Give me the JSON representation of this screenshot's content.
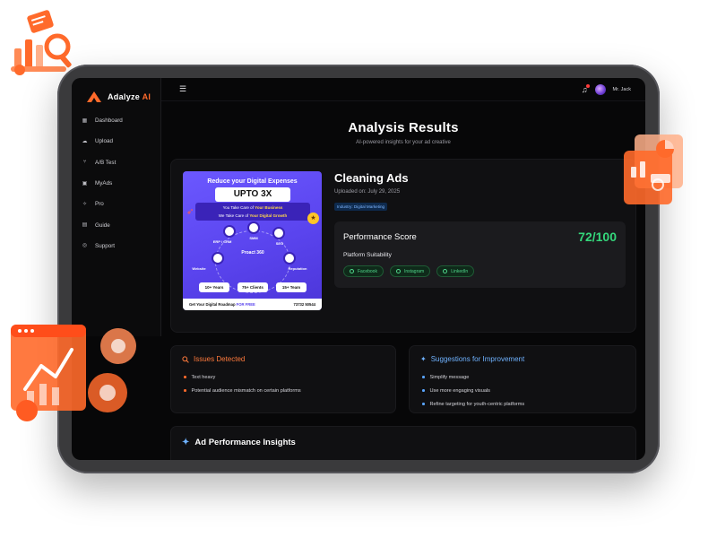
{
  "app": {
    "brand_name": "Adalyze",
    "brand_suffix": "AI"
  },
  "sidebar": {
    "items": [
      {
        "label": "Dashboard",
        "icon": "dashboard-icon"
      },
      {
        "label": "Upload",
        "icon": "upload-icon"
      },
      {
        "label": "A/B Test",
        "icon": "ab-test-icon"
      },
      {
        "label": "MyAds",
        "icon": "my-ads-icon"
      },
      {
        "label": "Pro",
        "icon": "pro-icon"
      },
      {
        "label": "Guide",
        "icon": "guide-icon"
      },
      {
        "label": "Support",
        "icon": "support-icon"
      }
    ]
  },
  "topbar": {
    "user_name": "Mr. Jack",
    "icons": [
      "menu-icon",
      "bell-icon",
      "avatar"
    ]
  },
  "page": {
    "title": "Analysis Results",
    "subtitle": "AI-powered insights for your ad creative"
  },
  "ad": {
    "title": "Cleaning Ads",
    "uploaded": "Uploaded on: July 29, 2025",
    "tag": "Industry: Digital Marketing",
    "creative": {
      "headline": "Reduce your Digital Expenses",
      "upto": "UPTO 3X",
      "line1_a": "You Take Care of ",
      "line1_b": "Your Business",
      "line2_a": "We Take Care of ",
      "line2_b": "Your Digital Growth",
      "center": "Proact 360",
      "nodes": [
        "ERP / CRM",
        "SMM",
        "SEO",
        "Website",
        "Reputation"
      ],
      "stats": [
        "10+ Years",
        "75+ Clients",
        "15+ Team"
      ],
      "footer_a": "Get Your Digital Roadmap ",
      "footer_b": "FOR FREE",
      "phone": "73732 50544"
    }
  },
  "performance": {
    "label": "Performance Score",
    "score": "72/100",
    "score_value": 72,
    "score_max": 100,
    "suitability_label": "Platform Suitability",
    "platforms": [
      "Facebook",
      "Instagram",
      "LinkedIn"
    ]
  },
  "issues": {
    "title": "Issues Detected",
    "items": [
      "Text heavy",
      "Potential audience mismatch on certain platforms"
    ]
  },
  "suggestions": {
    "title": "Suggestions for Improvement",
    "items": [
      "Simplify message",
      "Use more engaging visuals",
      "Refine targeting for youth-centric platforms"
    ]
  },
  "insights": {
    "title": "Ad Performance Insights"
  },
  "colors": {
    "accent": "#ff6a2b",
    "score_green": "#34d67b",
    "info_blue": "#6fb2ff",
    "background": "#070708"
  }
}
